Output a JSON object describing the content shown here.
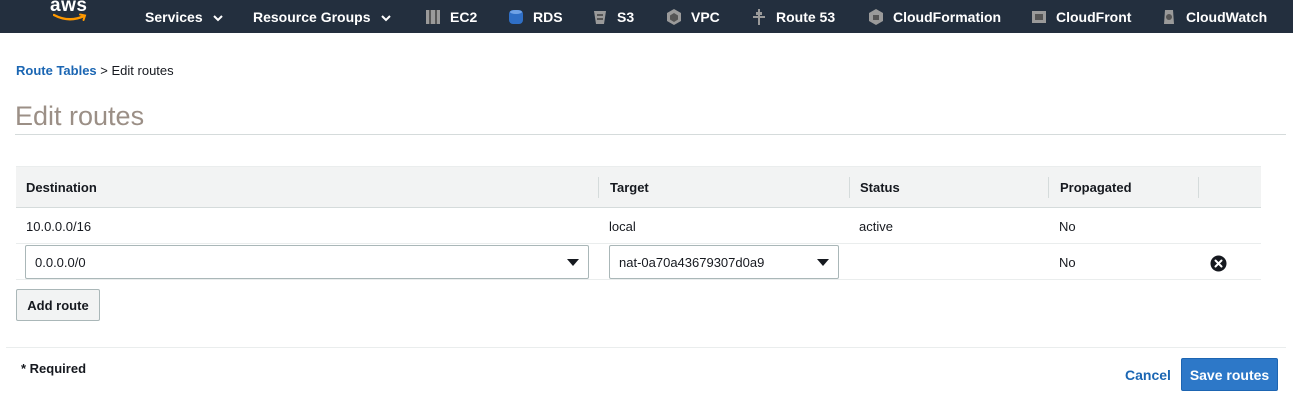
{
  "nav": {
    "logo_text": "aws",
    "services_label": "Services",
    "resource_groups_label": "Resource Groups",
    "shortcuts": [
      {
        "label": "EC2",
        "icon": "ec2-icon"
      },
      {
        "label": "RDS",
        "icon": "rds-icon"
      },
      {
        "label": "S3",
        "icon": "s3-icon"
      },
      {
        "label": "VPC",
        "icon": "vpc-icon"
      },
      {
        "label": "Route 53",
        "icon": "route53-icon"
      },
      {
        "label": "CloudFormation",
        "icon": "cloudformation-icon"
      },
      {
        "label": "CloudFront",
        "icon": "cloudfront-icon"
      },
      {
        "label": "CloudWatch",
        "icon": "cloudwatch-icon"
      }
    ]
  },
  "breadcrumb": {
    "parent": "Route Tables",
    "separator": " > ",
    "current": "Edit routes"
  },
  "page": {
    "title": "Edit routes"
  },
  "table": {
    "columns": [
      "Destination",
      "Target",
      "Status",
      "Propagated"
    ],
    "rows": [
      {
        "destination": "10.0.0.0/16",
        "target": "local",
        "status": "active",
        "propagated": "No"
      },
      {
        "destination": "0.0.0.0/0",
        "target": "nat-0a70a43679307d0a9",
        "status": "",
        "propagated": "No",
        "editable": true
      }
    ]
  },
  "buttons": {
    "add_route": "Add route",
    "cancel": "Cancel",
    "save_routes": "Save routes"
  },
  "footer": {
    "required_note": "* Required"
  },
  "colors": {
    "nav_bg": "#232f3e",
    "link": "#1b66b3",
    "primary": "#2d78c8",
    "title": "#9b8f86"
  }
}
